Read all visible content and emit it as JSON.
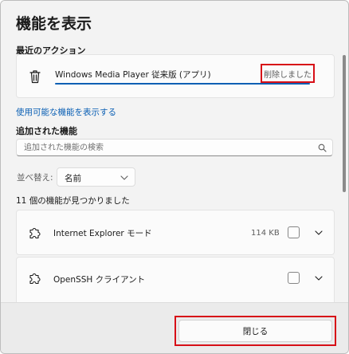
{
  "dialog": {
    "title": "機能を表示"
  },
  "recent_actions": {
    "label": "最近のアクション",
    "item": {
      "name": "Windows Media Player 従来版 (アプリ)",
      "status": "削除しました",
      "icon": "trash-icon",
      "progress_fraction": 1.0
    }
  },
  "available_features_link": "使用可能な機能を表示する",
  "added_features": {
    "label": "追加された機能",
    "search_placeholder": "追加された機能の検索",
    "search_value": "",
    "sort_label": "並べ替え:",
    "sort_value": "名前",
    "count_text": "11 個の機能が見つかりました",
    "items": [
      {
        "name": "Internet Explorer モード",
        "size": "114 KB",
        "icon": "puzzle-icon",
        "checked": false
      },
      {
        "name": "OpenSSH クライアント",
        "size": "",
        "icon": "puzzle-icon",
        "checked": false
      }
    ]
  },
  "footer": {
    "close_label": "閉じる"
  },
  "colors": {
    "accent": "#0a5fb4",
    "highlight": "#d70f17",
    "background": "#f3f3f3"
  }
}
